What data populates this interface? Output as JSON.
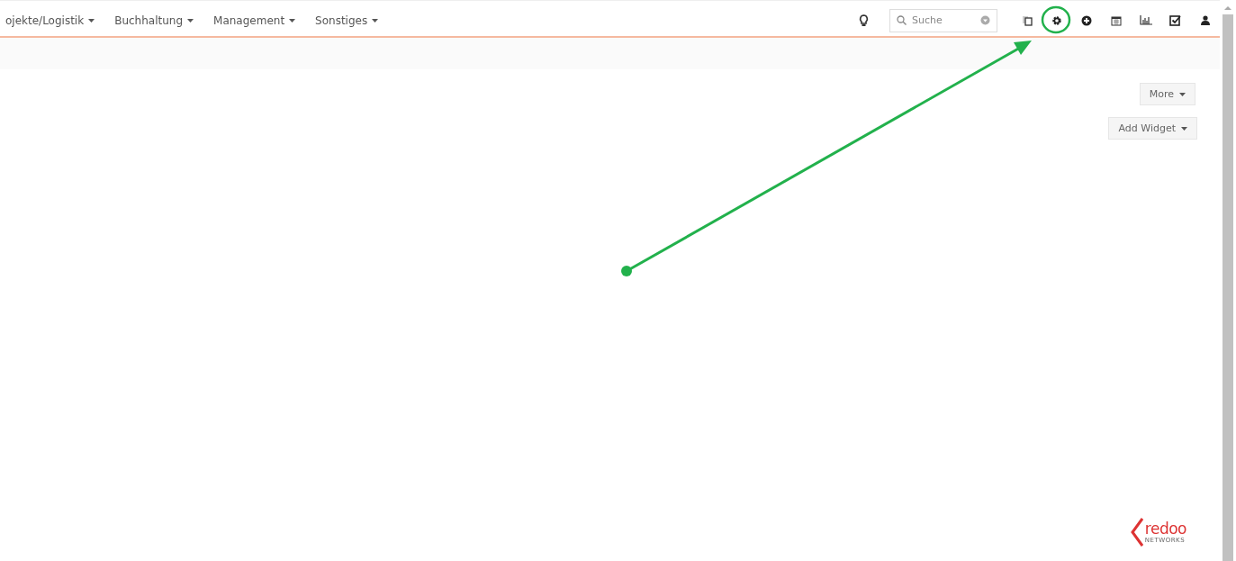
{
  "nav": {
    "menus": [
      {
        "label": "ojekte/Logistik"
      },
      {
        "label": "Buchhaltung"
      },
      {
        "label": "Management"
      },
      {
        "label": "Sonstiges"
      }
    ]
  },
  "search": {
    "placeholder": "Suche"
  },
  "dashboard": {
    "buttons": [
      {
        "label": "More"
      },
      {
        "label": "Add Widget"
      }
    ]
  },
  "logo": {
    "name": "redoo",
    "tagline": "NETWORKS"
  }
}
